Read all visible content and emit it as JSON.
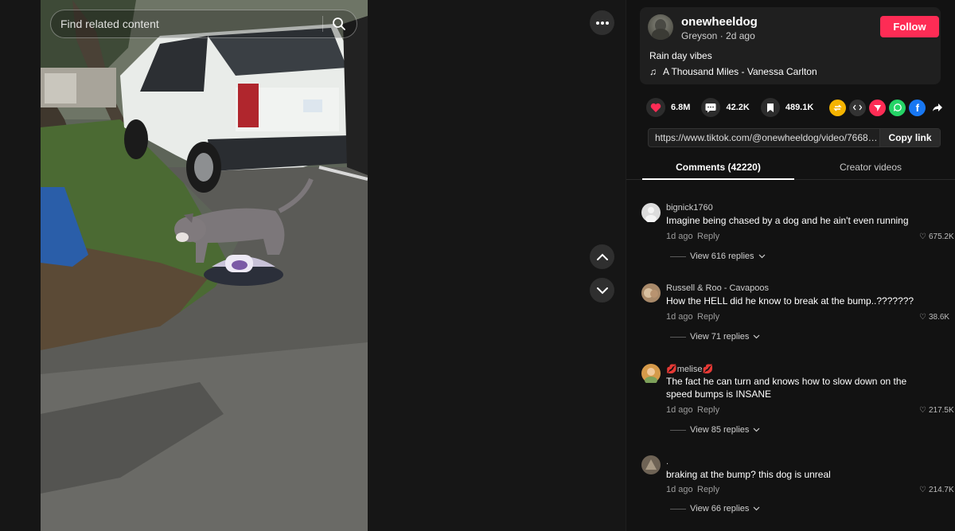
{
  "search": {
    "placeholder": "Find related content"
  },
  "video": {
    "description_for_playback": ""
  },
  "author": {
    "username": "onewheeldog",
    "display_name": "Greyson",
    "posted": "2d ago",
    "follow_label": "Follow",
    "caption": "Rain day vibes",
    "music": "A Thousand Miles - Vanessa Carlton"
  },
  "stats": {
    "likes": "6.8M",
    "comments": "42.2K",
    "saves": "489.1K"
  },
  "share_link": {
    "url": "https://www.tiktok.com/@onewheeldog/video/766845...",
    "copy_label": "Copy link"
  },
  "tabs": {
    "comments": "Comments (42220)",
    "creator": "Creator videos"
  },
  "comments": [
    {
      "user": "bignick1760",
      "text": "Imagine being chased by a dog and he ain't even running",
      "time": "1d ago",
      "reply": "Reply",
      "likes": "675.2K",
      "view_replies": "View 616 replies"
    },
    {
      "user": "Russell & Roo - Cavapoos",
      "text": "How the HELL did he know to break at the bump..???????",
      "time": "1d ago",
      "reply": "Reply",
      "likes": "38.6K",
      "view_replies": "View 71 replies"
    },
    {
      "user": "💋melise💋",
      "text": "The fact he can turn and knows how to slow down on the speed bumps is INSANE",
      "time": "1d ago",
      "reply": "Reply",
      "likes": "217.5K",
      "view_replies": "View 85 replies"
    },
    {
      "user": ".",
      "text": "braking at the bump? this dog is unreal",
      "time": "1d ago",
      "reply": "Reply",
      "likes": "214.7K",
      "view_replies": "View 66 replies"
    }
  ],
  "colors": {
    "accent": "#fe2c55",
    "panel_bg": "#121212",
    "card_bg": "#1f1f1f"
  }
}
